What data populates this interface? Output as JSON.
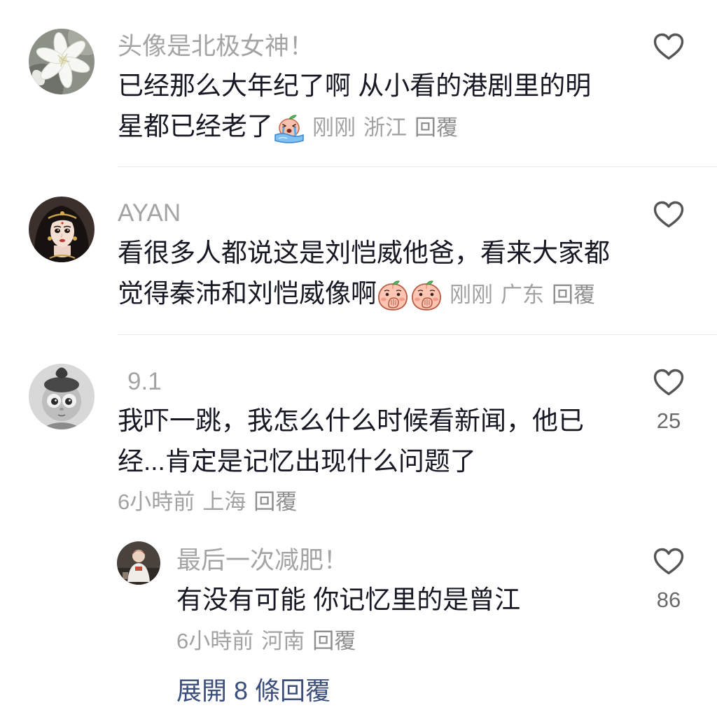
{
  "comments": [
    {
      "username": "头像是北极女神！",
      "text": "已经那么大年纪了啊 从小看的港剧里的明星都已经老了",
      "emojis": [
        "crying-peach-emoji"
      ],
      "time": "刚刚",
      "location": "浙江",
      "reply_label": "回覆"
    },
    {
      "username": "AYAN",
      "text": "看很多人都说这是刘恺威他爸，看来大家都觉得秦沛和刘恺威像啊",
      "emojis": [
        "cover-mouth-peach-emoji",
        "cover-mouth-peach-emoji"
      ],
      "time": "刚刚",
      "location": "广东",
      "reply_label": "回覆"
    },
    {
      "username": "9.1",
      "text": "我吓一跳，我怎么什么时候看新闻，他已经...肯定是记忆出现什么问题了",
      "time": "6小時前",
      "location": "上海",
      "reply_label": "回覆",
      "like_count": "25",
      "replies": [
        {
          "username": "最后一次减肥！",
          "text": "有没有可能 你记忆里的是曾江",
          "time": "6小時前",
          "location": "河南",
          "reply_label": "回覆",
          "like_count": "86"
        }
      ],
      "expand_replies_label": "展開 8 條回覆"
    }
  ],
  "icons": {
    "like": "heart-outline-icon"
  },
  "colors": {
    "text": "#161823",
    "secondary_text": "#a2a2a2",
    "expand_link": "#3c4e7c",
    "background": "#ffffff"
  }
}
